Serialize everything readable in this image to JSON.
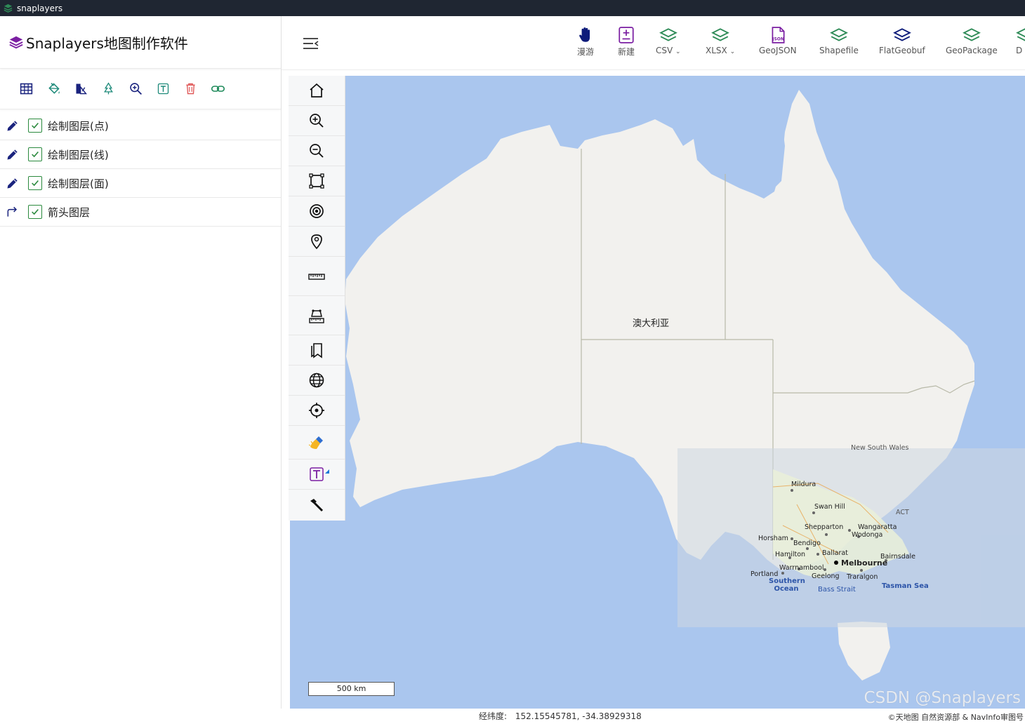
{
  "window": {
    "title": "snaplayers"
  },
  "brand": {
    "title": "Snaplayers地图制作软件",
    "color": "#7b1fa2"
  },
  "layer_toolbar": {
    "icons": [
      "table-icon",
      "paint-bucket-icon",
      "style-icon",
      "tree-icon",
      "zoom-to-layer-icon",
      "text-icon",
      "delete-icon",
      "link-icon"
    ]
  },
  "layers": [
    {
      "name": "绘制图层(点)",
      "checked": true,
      "icon": "pencil-icon"
    },
    {
      "name": "绘制图层(线)",
      "checked": true,
      "icon": "pencil-icon"
    },
    {
      "name": "绘制图层(面)",
      "checked": true,
      "icon": "pencil-icon"
    },
    {
      "name": "箭头图层",
      "checked": true,
      "icon": "arrow-turn-icon"
    }
  ],
  "header": {
    "buttons": [
      {
        "label": "漫游",
        "icon": "hand-icon"
      },
      {
        "label": "新建",
        "icon": "new-file-icon"
      },
      {
        "label": "CSV",
        "icon": "layers-icon",
        "dropdown": true
      },
      {
        "label": "XLSX",
        "icon": "layers-icon",
        "dropdown": true
      },
      {
        "label": "GeoJSON",
        "icon": "json-file-icon"
      },
      {
        "label": "Shapefile",
        "icon": "layers-icon"
      },
      {
        "label": "FlatGeobuf",
        "icon": "layers-icon"
      },
      {
        "label": "GeoPackage",
        "icon": "layers-icon"
      },
      {
        "label": "D",
        "icon": "layers-icon"
      }
    ]
  },
  "map_tools": [
    "home-icon",
    "zoom-in-icon",
    "zoom-out-icon",
    "extent-icon",
    "target-icon",
    "location-pin-icon",
    "measure-distance-icon",
    "measure-area-icon",
    "bookmark-icon",
    "globe-icon",
    "locate-icon",
    "clear-brush-icon",
    "text-tool-icon",
    "hammer-icon"
  ],
  "map": {
    "country_label": "澳大利亚",
    "inset_labels": {
      "nsw": "New South Wales",
      "mildura": "Mildura",
      "swan_hill": "Swan Hill",
      "act": "ACT",
      "shepparton": "Shepparton",
      "wangaratta": "Wangaratta",
      "wodonga": "Wodonga",
      "horsham": "Horsham",
      "bendigo": "Bendigo",
      "hamilton": "Hamilton",
      "ballarat": "Ballarat",
      "bairnsdale": "Bairnsdale",
      "melbourne": "Melbourne",
      "warrnambool": "Warrnambool",
      "portland": "Portland",
      "geelong": "Geelong",
      "traralgon": "Traralgon",
      "southern_ocean": "Southern Ocean",
      "bass_strait": "Bass Strait",
      "tasman_sea": "Tasman Sea"
    },
    "scale": "500 km",
    "colors": {
      "water": "#aac6ee",
      "land": "#f2f1ee",
      "border": "#b8b9a8"
    }
  },
  "footer": {
    "coord_label": "经纬度:",
    "coord_value": "152.15545781, -34.38929318",
    "attribution": "©天地图 自然资源部 & NavInfo审图号",
    "watermark": "CSDN @Snaplayers"
  }
}
